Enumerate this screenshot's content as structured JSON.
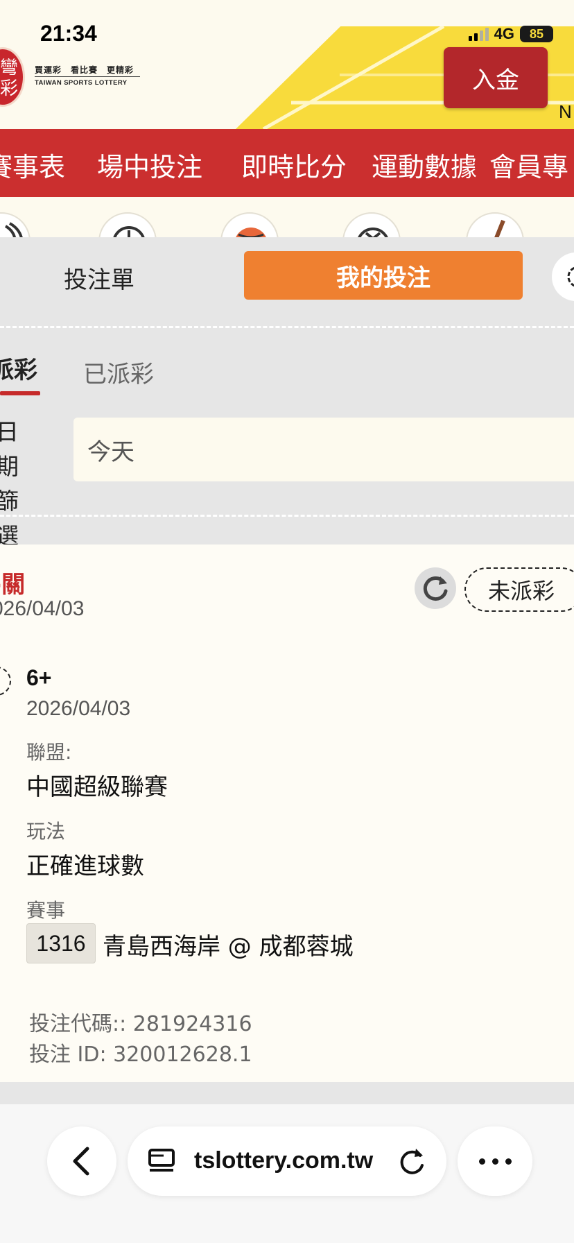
{
  "status_bar": {
    "time": "21:34",
    "network": "4G",
    "battery": "85"
  },
  "header": {
    "logo_glyphs": "彎彩",
    "logo_tagline": "買運彩　看比賽　更精彩",
    "logo_subtitle": "TAIWAN SPORTS LOTTERY",
    "deposit_label": "入金",
    "edge_letter": "N"
  },
  "nav": {
    "items": [
      "賽事表",
      "場中投注",
      "即時比分",
      "運動數據",
      "會員專"
    ]
  },
  "sport_icons": [
    "volleyball-icon",
    "baseball-icon",
    "basketball-icon",
    "soccer-icon",
    "hockey-icon"
  ],
  "bet_panel": {
    "tab_slip": "投注單",
    "tab_my_bets": "我的投注",
    "subtab_unpaid": "派彩",
    "subtab_paid": "已派彩",
    "date_filter_label": "日期篩選",
    "date_filter_value": "今天"
  },
  "bet_card": {
    "bet_type": "-關",
    "placed_date": "026/04/03",
    "status": "未派彩",
    "selection": "6+",
    "selection_date": "2026/04/03",
    "league_label": "聯盟:",
    "league_value": "中國超級聯賽",
    "market_label": "玩法",
    "market_value": "正確進球數",
    "event_label": "賽事",
    "event_code": "1316",
    "event_teams": "青島西海岸 @ 成都蓉城",
    "bet_code": "投注代碼:: 281924316",
    "bet_id": "投注 ID: 320012628.1"
  },
  "browser": {
    "url": "tslottery.com.tw"
  },
  "colors": {
    "brand_red": "#cb2f2f",
    "deposit_red": "#b3272b",
    "accent_orange": "#ef8030",
    "yellow": "#f8db3c"
  }
}
